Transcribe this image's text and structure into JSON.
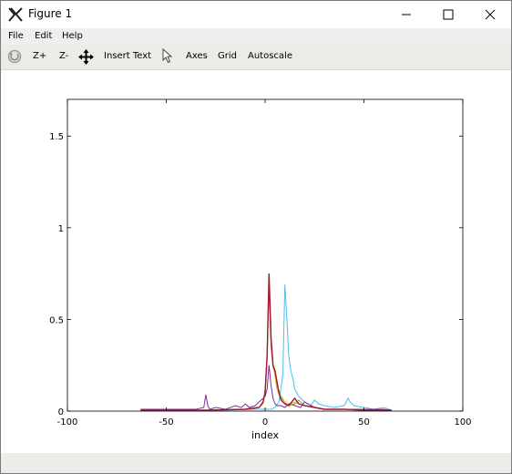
{
  "window": {
    "title": "Figure 1"
  },
  "menu": {
    "file": "File",
    "edit": "Edit",
    "help": "Help"
  },
  "toolbar": {
    "zoom_in": "Z+",
    "zoom_out": "Z-",
    "insert_text": "Insert Text",
    "axes": "Axes",
    "grid": "Grid",
    "autoscale": "Autoscale"
  },
  "icons": {
    "app": "x-app-icon",
    "rotate": "rotate-icon",
    "pan": "pan-arrows-icon",
    "select": "pointer-icon",
    "minimize": "minimize-icon",
    "maximize": "maximize-icon",
    "close": "close-icon"
  },
  "chart_data": {
    "type": "line",
    "title": "",
    "xlabel": "index",
    "ylabel": "",
    "xlim": [
      -100,
      100
    ],
    "ylim": [
      0,
      1.7
    ],
    "xticks": [
      "-100",
      "-50",
      "0",
      "50",
      "100"
    ],
    "yticks": [
      "0",
      "0.5",
      "1",
      "1.5"
    ],
    "grid": false,
    "series": [
      {
        "color": "#4dbeee",
        "x": [
          -63,
          -40,
          -20,
          -5,
          0,
          3,
          5,
          7,
          9,
          10,
          11,
          12,
          13,
          14,
          15,
          17,
          20,
          23,
          25,
          27,
          30,
          35,
          40,
          42,
          43,
          45,
          50,
          55,
          60,
          64
        ],
        "y": [
          0.005,
          0.005,
          0.005,
          0.01,
          0.01,
          0.01,
          0.02,
          0.05,
          0.2,
          0.69,
          0.5,
          0.3,
          0.22,
          0.18,
          0.12,
          0.08,
          0.05,
          0.03,
          0.06,
          0.04,
          0.03,
          0.02,
          0.03,
          0.07,
          0.05,
          0.03,
          0.02,
          0.01,
          0.02,
          0.005
        ]
      },
      {
        "color": "#7e2f8e",
        "x": [
          -63,
          -45,
          -35,
          -31,
          -30,
          -29,
          -28,
          -25,
          -20,
          -15,
          -12,
          -10,
          -8,
          -5,
          -3,
          0,
          1,
          2,
          3,
          4,
          5,
          6,
          8,
          10,
          12,
          15,
          18,
          20,
          25,
          30,
          40,
          50,
          60,
          64
        ],
        "y": [
          0.01,
          0.01,
          0.01,
          0.02,
          0.09,
          0.03,
          0.01,
          0.02,
          0.01,
          0.03,
          0.02,
          0.04,
          0.02,
          0.03,
          0.05,
          0.08,
          0.12,
          0.25,
          0.14,
          0.07,
          0.04,
          0.03,
          0.03,
          0.02,
          0.04,
          0.03,
          0.02,
          0.05,
          0.02,
          0.01,
          0.01,
          0.01,
          0.01,
          0.005
        ]
      },
      {
        "color": "#77ac30",
        "x": [
          -63,
          -30,
          -10,
          -3,
          -1,
          0,
          1,
          2,
          3,
          4,
          5,
          6,
          8,
          10,
          12,
          15,
          17,
          20,
          25,
          30,
          40,
          50,
          64
        ],
        "y": [
          0.005,
          0.005,
          0.01,
          0.02,
          0.05,
          0.12,
          0.3,
          0.68,
          0.35,
          0.24,
          0.2,
          0.14,
          0.08,
          0.05,
          0.03,
          0.04,
          0.06,
          0.03,
          0.02,
          0.01,
          0.01,
          0.005,
          0.005
        ]
      },
      {
        "color": "#edb120",
        "x": [
          -63,
          -30,
          -10,
          -3,
          -1,
          0,
          1,
          2,
          3,
          4,
          5,
          6,
          8,
          10,
          12,
          15,
          17,
          20,
          25,
          30,
          40,
          50,
          64
        ],
        "y": [
          0.005,
          0.005,
          0.01,
          0.02,
          0.04,
          0.1,
          0.28,
          0.7,
          0.38,
          0.26,
          0.19,
          0.12,
          0.07,
          0.05,
          0.03,
          0.05,
          0.04,
          0.03,
          0.02,
          0.01,
          0.01,
          0.005,
          0.005
        ]
      },
      {
        "color": "#a2142f",
        "x": [
          -63,
          -30,
          -10,
          -3,
          -1,
          0,
          1,
          2,
          3,
          4,
          5,
          6,
          7,
          8,
          10,
          12,
          15,
          17,
          20,
          25,
          30,
          40,
          50,
          64
        ],
        "y": [
          0.005,
          0.005,
          0.01,
          0.02,
          0.05,
          0.1,
          0.3,
          0.75,
          0.4,
          0.25,
          0.22,
          0.16,
          0.1,
          0.06,
          0.04,
          0.03,
          0.07,
          0.04,
          0.03,
          0.02,
          0.01,
          0.01,
          0.005,
          0.005
        ]
      }
    ]
  }
}
